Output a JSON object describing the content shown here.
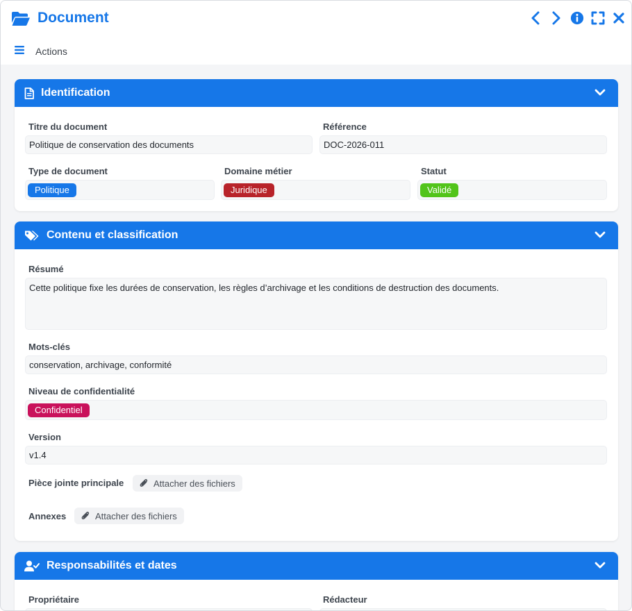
{
  "window": {
    "title": "Document",
    "actions_label": "Actions"
  },
  "colors": {
    "accent": "#1677e8",
    "tag_type": "#1677e8",
    "tag_domain": "#b8232a",
    "tag_status": "#52c41a",
    "tag_confidentiality": "#c9115b"
  },
  "icons": [
    "folder-open-icon",
    "chevron-left-icon",
    "chevron-right-icon",
    "info-icon",
    "expand-icon",
    "close-icon",
    "menu-icon",
    "document-icon",
    "tags-icon",
    "user-check-icon",
    "chevron-down-icon",
    "paperclip-icon"
  ],
  "identification": {
    "title": "Identification",
    "titre_label": "Titre du document",
    "titre_value": "Politique de conservation des documents",
    "reference_label": "Référence",
    "reference_value": "DOC-2026-011",
    "type_label": "Type de document",
    "type_value": "Politique",
    "domaine_label": "Domaine métier",
    "domaine_value": "Juridique",
    "statut_label": "Statut",
    "statut_value": "Validé"
  },
  "contenu": {
    "title": "Contenu et classification",
    "resume_label": "Résumé",
    "resume_value": "Cette politique fixe les durées de conservation, les règles d’archivage et les conditions de destruction des documents.",
    "mots_label": "Mots-clés",
    "mots_value": "conservation, archivage, conformité",
    "niveau_label": "Niveau de confidentialité",
    "niveau_value": "Confidentiel",
    "version_label": "Version",
    "version_value": "v1.4",
    "piece_label": "Pièce jointe principale",
    "piece_button": "Attacher des fichiers",
    "annexes_label": "Annexes",
    "annexes_button": "Attacher des fichiers"
  },
  "responsabilites": {
    "title": "Responsabilités et dates",
    "proprietaire_label": "Propriétaire",
    "redacteur_label": "Rédacteur"
  }
}
